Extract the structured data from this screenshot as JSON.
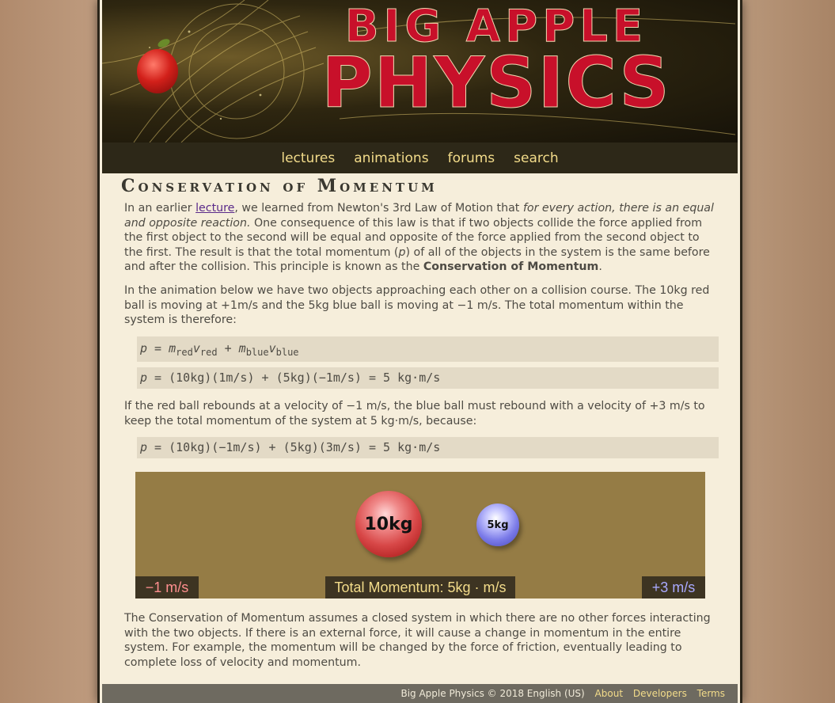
{
  "banner": {
    "line1": "BIG APPLE",
    "line2": "PHYSICS"
  },
  "nav": {
    "items": [
      "lectures",
      "animations",
      "forums",
      "search"
    ]
  },
  "page_title": "Conservation of Momentum",
  "para1": {
    "t1": "In an earlier ",
    "link": "lecture",
    "t2": ", we learned from Newton's 3rd Law of Motion that ",
    "italic": "for every action, there is an equal and opposite reaction.",
    "t3": " One consequence of this law is that if two objects collide the force applied from the first object to the second will be equal and opposite of the force applied from the second object to the first. The result is that the total momentum (",
    "p": "p",
    "t4": ") of all of the objects in the system is the same before and after the collision. This principle is known as the ",
    "bold": "Conservation of Momentum",
    "t5": "."
  },
  "para2": "In the animation below we have two objects approaching each other on a collision course. The 10kg red ball is moving at +1m/s and the 5kg blue ball is moving at −1 m/s. The total momentum within the system is therefore:",
  "eq1": {
    "p": "p",
    "eq": " = ",
    "m1": "m",
    "s1": "red",
    "v1": "v",
    "s2": "red",
    "plus": " + ",
    "m2": "m",
    "s3": "blue",
    "v2": "v",
    "s4": "blue"
  },
  "eq2": {
    "p": "p",
    "rest": " = (10kg)(1m/s) + (5kg)(−1m/s) = 5 kg·m/s"
  },
  "para3": "If the red ball rebounds at a velocity of −1 m/s, the blue ball must rebound with a velocity of +3 m/s to keep the total momentum of the system at 5 kg·m/s, because:",
  "eq3": {
    "p": "p",
    "rest": " = (10kg)(−1m/s) + (5kg)(3m/s) = 5 kg·m/s"
  },
  "animation": {
    "red_ball": "10kg",
    "blue_ball": "5kg",
    "red_velocity": "−1 m/s",
    "total": "Total Momentum: 5kg · m/s",
    "blue_velocity": "+3 m/s",
    "red_color": "#ff8f8f",
    "blue_color": "#a9a9ff",
    "total_color": "#f3dc8a"
  },
  "para4": "The Conservation of Momentum assumes a closed system in which there are no other forces interacting with the two objects. If there is an external force, it will cause a change in momentum in the entire system. For example, the momentum will be changed by the force of friction, eventually leading to complete loss of velocity and momentum.",
  "footer": {
    "text": "Big Apple Physics © 2018 English (US)",
    "links": [
      "About",
      "Developers",
      "Terms"
    ]
  }
}
